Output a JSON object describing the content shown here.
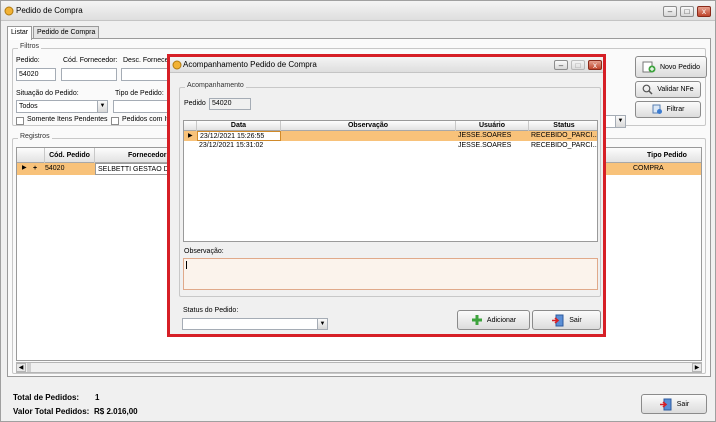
{
  "window": {
    "title": "Pedido de Compra"
  },
  "tabs": [
    {
      "label": "Listar"
    },
    {
      "label": "Pedido de Compra"
    }
  ],
  "filters": {
    "group_title": "Filtros",
    "pedido_label": "Pedido:",
    "pedido_value": "54020",
    "cod_fornecedor_label": "Cód. Fornecedor:",
    "cod_fornecedor_value": "",
    "desc_fornecedor_label": "Desc. Fornecedor:",
    "desc_fornecedor_value": "",
    "situacao_label": "Situação do Pedido:",
    "situacao_value": "Todos",
    "tipo_label": "Tipo de Pedido:",
    "tipo_value": "",
    "somente_itens_label": "Somente Itens Pendentes",
    "pedidos_com_label": "Pedidos com Itens"
  },
  "actions": {
    "novo_pedido": "Novo Pedido",
    "validar_nfe": "Validar NFe",
    "filtrar": "Filtrar"
  },
  "registros": {
    "group_title": "Registros",
    "columns": [
      "Cód. Pedido",
      "Fornecedor",
      "Tipo Pedido"
    ],
    "rows": [
      {
        "cod": "54020",
        "fornecedor": "SELBETTI GESTAO DE",
        "tipo": "COMPRA"
      }
    ]
  },
  "totals": {
    "total_pedidos_label": "Total de Pedidos:",
    "total_pedidos_value": "1",
    "valor_total_label": "Valor Total Pedidos:",
    "valor_total_value": "R$ 2.016,00"
  },
  "main_exit": "Sair",
  "dialog": {
    "title": "Acompanhamento Pedido de Compra",
    "group_title": "Acompanhamento",
    "pedido_label": "Pedido",
    "pedido_value": "54020",
    "columns": [
      "Data",
      "Observação",
      "Usuário",
      "Status"
    ],
    "rows": [
      {
        "data": "23/12/2021 15:26:55",
        "observacao": "",
        "usuario": "JESSE.SOARES",
        "status": "RECEBIDO_PARCI..."
      },
      {
        "data": "23/12/2021 15:31:02",
        "observacao": "",
        "usuario": "JESSE.SOARES",
        "status": "RECEBIDO_PARCI..."
      }
    ],
    "observacao_label": "Observação:",
    "observacao_value": "",
    "status_label": "Status do Pedido:",
    "status_value": "",
    "adicionar": "Adicionar",
    "sair": "Sair"
  },
  "colors": {
    "selected_row": "#f8c27a",
    "dialog_border": "#d61f26",
    "grid_header": "#e2e2e2"
  }
}
